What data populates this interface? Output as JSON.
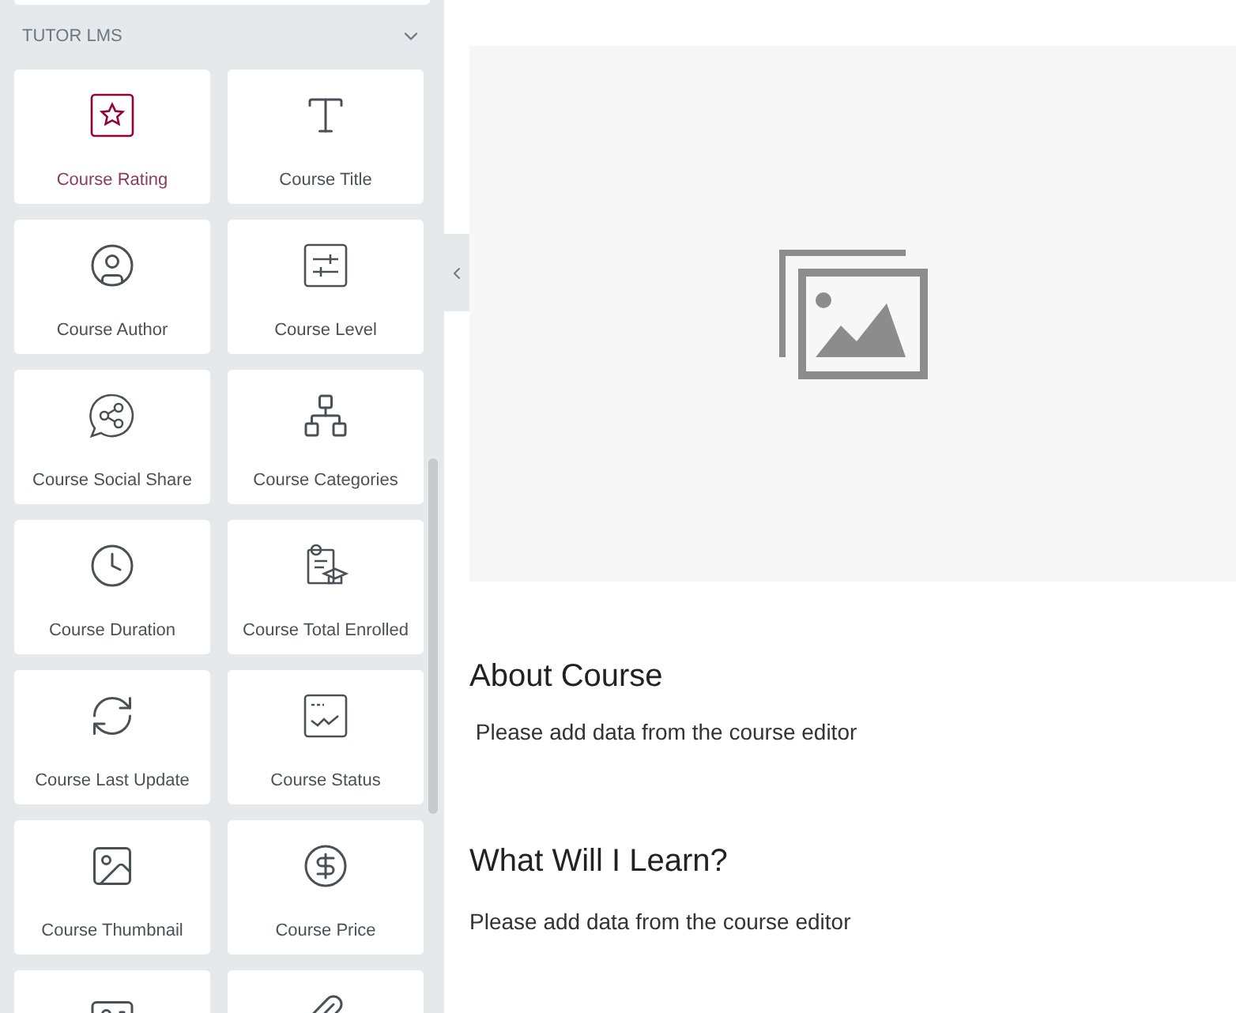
{
  "sidebar": {
    "section": {
      "title": "TUTOR LMS",
      "expanded": true
    },
    "widgets": [
      {
        "label": "Course Rating",
        "selected": true
      },
      {
        "label": "Course Title",
        "selected": false
      },
      {
        "label": "Course Author",
        "selected": false
      },
      {
        "label": "Course Level",
        "selected": false
      },
      {
        "label": "Course Social Share",
        "selected": false
      },
      {
        "label": "Course Categories",
        "selected": false
      },
      {
        "label": "Course Duration",
        "selected": false
      },
      {
        "label": "Course Total Enrolled",
        "selected": false
      },
      {
        "label": "Course Last Update",
        "selected": false
      },
      {
        "label": "Course Status",
        "selected": false
      },
      {
        "label": "Course Thumbnail",
        "selected": false
      },
      {
        "label": "Course Price",
        "selected": false
      },
      {
        "selected": false
      },
      {
        "selected": false
      }
    ]
  },
  "content": {
    "sections": [
      {
        "heading": "About Course",
        "text": " Please add data from the course editor"
      },
      {
        "heading": "What Will I Learn?",
        "text": "Please add data from the course editor"
      }
    ]
  }
}
